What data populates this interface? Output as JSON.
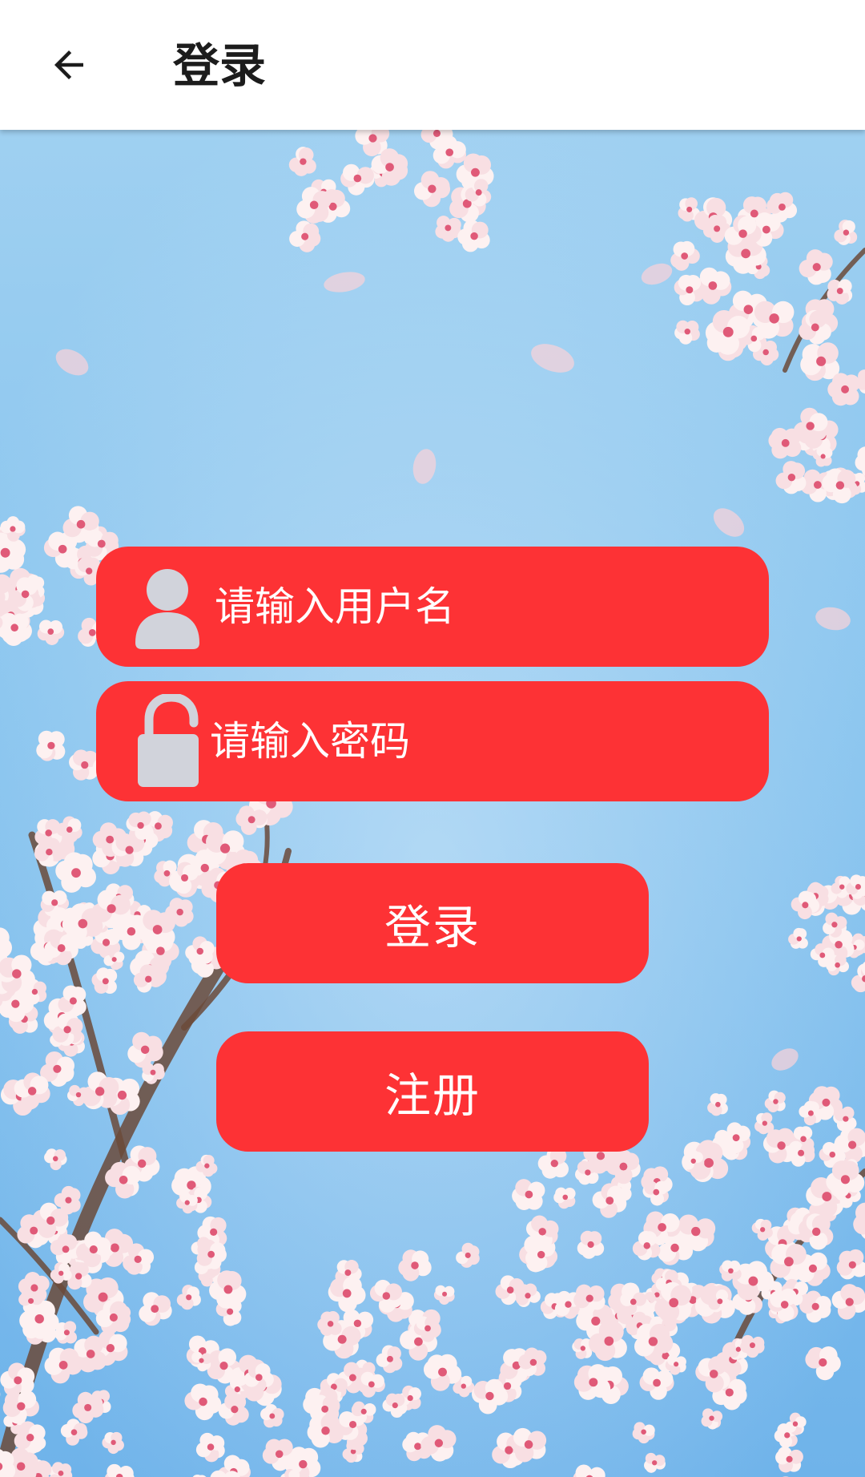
{
  "appbar": {
    "title": "登录",
    "back_icon": "arrow-left-icon"
  },
  "form": {
    "username": {
      "placeholder": "请输入用户名",
      "value": "",
      "icon": "user-icon"
    },
    "password": {
      "placeholder": "请输入密码",
      "value": "",
      "icon": "unlock-icon"
    },
    "login_label": "登录",
    "register_label": "注册"
  },
  "colors": {
    "accent": "#fd3235",
    "appbar_bg": "#ffffff",
    "title_text": "#1c1c1c",
    "icon_gray": "#d1d3db",
    "sky": "#8cc6ee"
  }
}
